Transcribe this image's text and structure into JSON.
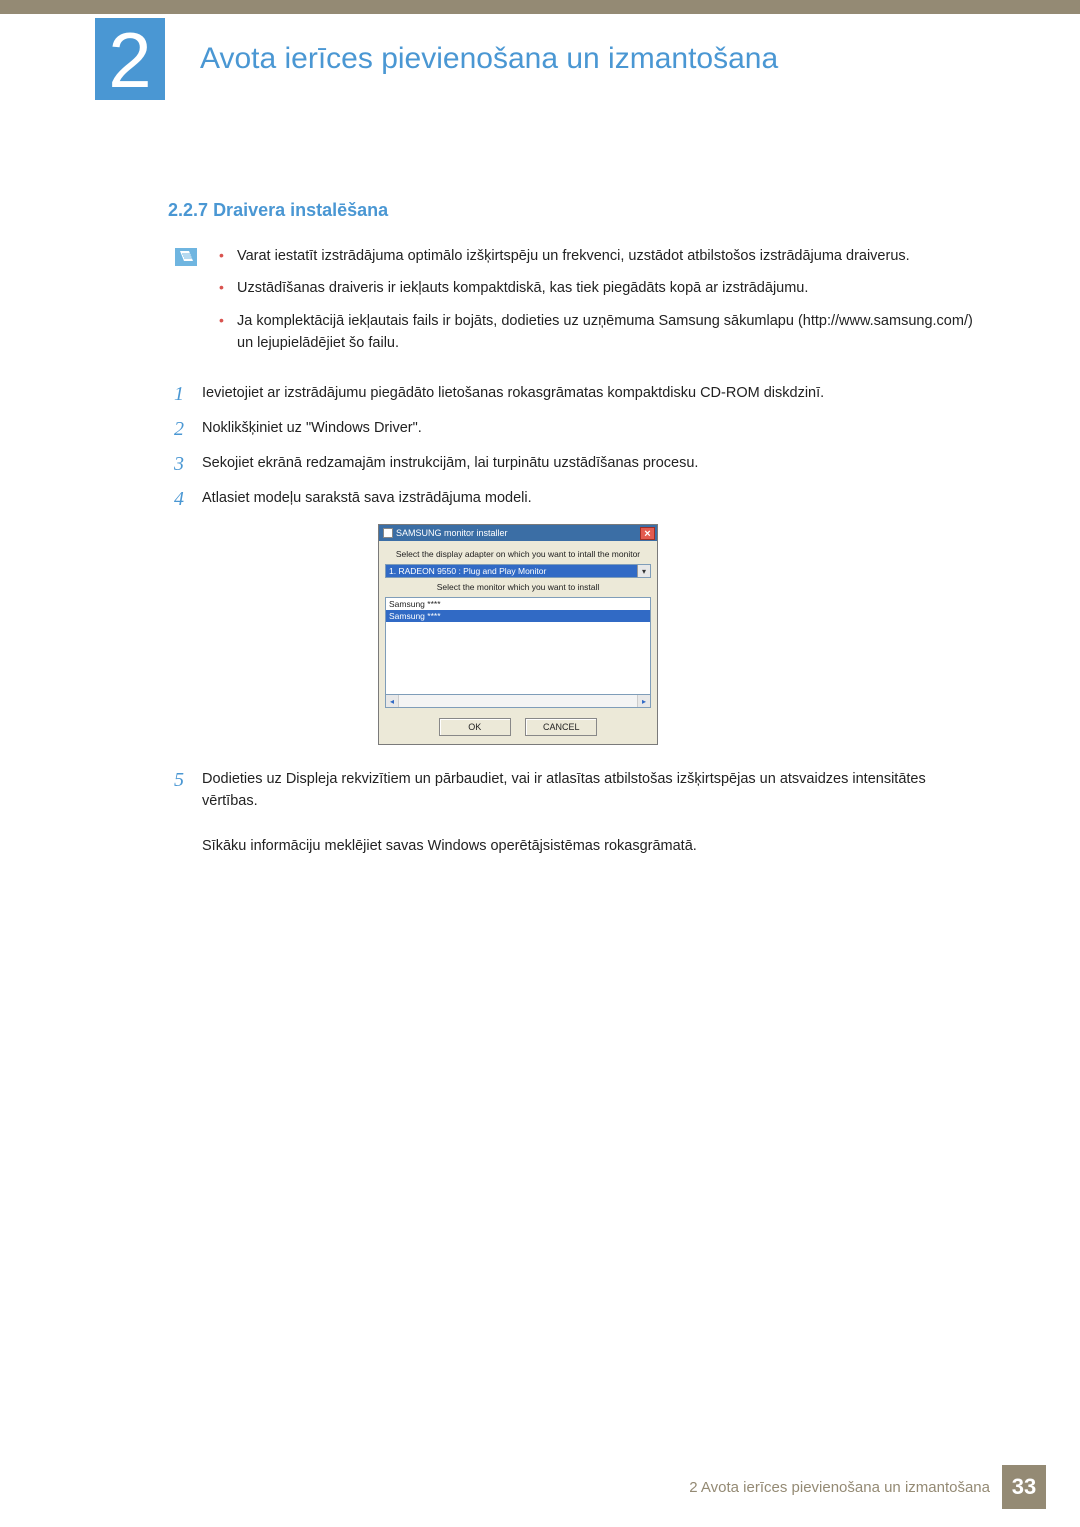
{
  "header": {
    "chapter_number": "2",
    "chapter_title": "Avota ierīces pievienošana un izmantošana"
  },
  "section": {
    "number": "2.2.7",
    "title": "Draivera instalēšana"
  },
  "notes": [
    "Varat iestatīt izstrādājuma optimālo izšķirtspēju un frekvenci, uzstādot atbilstošos izstrādājuma draiverus.",
    "Uzstādīšanas draiveris ir iekļauts kompaktdiskā, kas tiek piegādāts kopā ar izstrādājumu.",
    "Ja komplektācijā iekļautais fails ir bojāts, dodieties uz uzņēmuma Samsung sākumlapu (http://www.samsung.com/) un lejupielādējiet šo failu."
  ],
  "steps": {
    "s1": "Ievietojiet ar izstrādājumu piegādāto lietošanas rokasgrāmatas kompaktdisku CD-ROM diskdzinī.",
    "s2": "Noklikšķiniet uz \"Windows Driver\".",
    "s3": "Sekojiet ekrānā redzamajām instrukcijām, lai turpinātu uzstādīšanas procesu.",
    "s4": "Atlasiet modeļu sarakstā sava izstrādājuma modeli.",
    "s5a": "Dodieties uz Displeja rekvizītiem un pārbaudiet, vai ir atlasītas atbilstošas izšķirtspējas un atsvaidzes intensitātes vērtības.",
    "s5b": "Sīkāku informāciju meklējiet savas Windows operētājsistēmas rokasgrāmatā."
  },
  "installer": {
    "title": "SAMSUNG monitor installer",
    "label_adapter": "Select the display adapter on which you want to intall the monitor",
    "adapter_selected": "1. RADEON 9550 : Plug and Play Monitor",
    "label_monitor": "Select the monitor which you want to install",
    "rows": [
      "Samsung ****",
      "Samsung ****"
    ],
    "ok": "OK",
    "cancel": "CANCEL"
  },
  "footer": {
    "text": "2 Avota ierīces pievienošana un izmantošana",
    "page": "33"
  }
}
